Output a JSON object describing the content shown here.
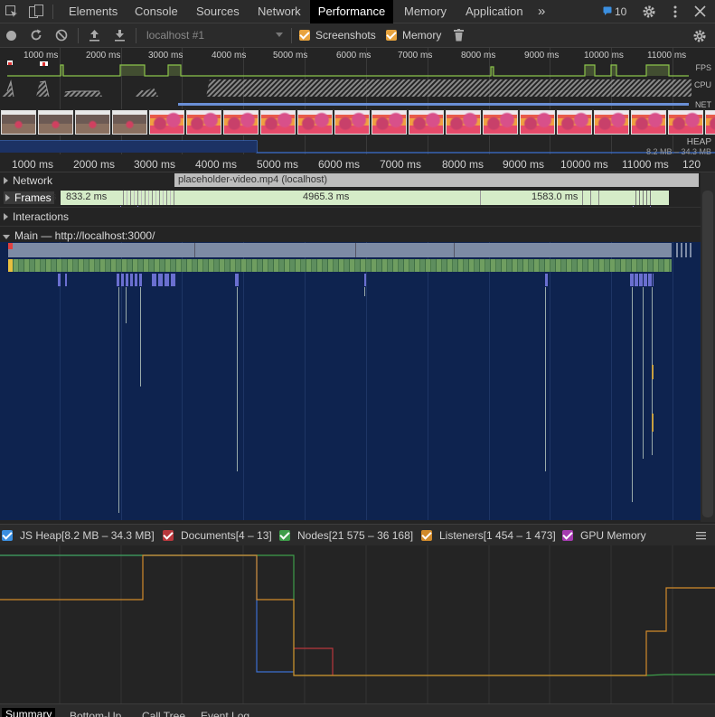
{
  "tabs": {
    "elements": "Elements",
    "console": "Console",
    "sources": "Sources",
    "network": "Network",
    "performance": "Performance",
    "memory": "Memory",
    "application": "Application",
    "more": "»",
    "issues_count": "10"
  },
  "toolbar": {
    "profile_select": "localhost #1",
    "screenshots_label": "Screenshots",
    "memory_label": "Memory"
  },
  "overview": {
    "ticks": [
      "1000 ms",
      "2000 ms",
      "3000 ms",
      "4000 ms",
      "5000 ms",
      "6000 ms",
      "7000 ms",
      "8000 ms",
      "9000 ms",
      "10000 ms",
      "11000 ms"
    ],
    "fps_label": "FPS",
    "cpu_label": "CPU",
    "net_label": "NET",
    "heap_label": "HEAP",
    "heap_range": "8.2 MB – 34.3 MB"
  },
  "ruler": {
    "ticks": [
      "1000 ms",
      "2000 ms",
      "3000 ms",
      "4000 ms",
      "5000 ms",
      "6000 ms",
      "7000 ms",
      "8000 ms",
      "9000 ms",
      "10000 ms",
      "11000 ms",
      "120"
    ]
  },
  "tracks": {
    "network_label": "Network",
    "network_request": "placeholder-video.mp4 (localhost)",
    "frames_label": "Frames",
    "frames_prefix": "s",
    "frame_1": "833.2 ms",
    "frame_2": "4965.3 ms",
    "frame_3": "1583.0 ms",
    "interactions_label": "Interactions",
    "main_label": "Main — http://localhost:3000/"
  },
  "legend": {
    "js_heap": "JS Heap[8.2 MB – 34.3 MB]",
    "documents": "Documents[4 – 13]",
    "nodes": "Nodes[21 575 – 36 168]",
    "listeners": "Listeners[1 454 – 1 473]",
    "gpu_memory": "GPU Memory"
  },
  "bottom_tabs": {
    "summary": "Summary",
    "bottom_up": "Bottom-Up",
    "call_tree": "Call Tree",
    "event_log": "Event Log"
  },
  "colors": {
    "accent_orange": "#e8a33d",
    "js_heap": "#3b8fe0",
    "documents": "#b8373c",
    "nodes": "#3e9d4a",
    "listeners": "#d18a2b",
    "gpu": "#a53bb0",
    "flame_bg": "#0e234f"
  }
}
